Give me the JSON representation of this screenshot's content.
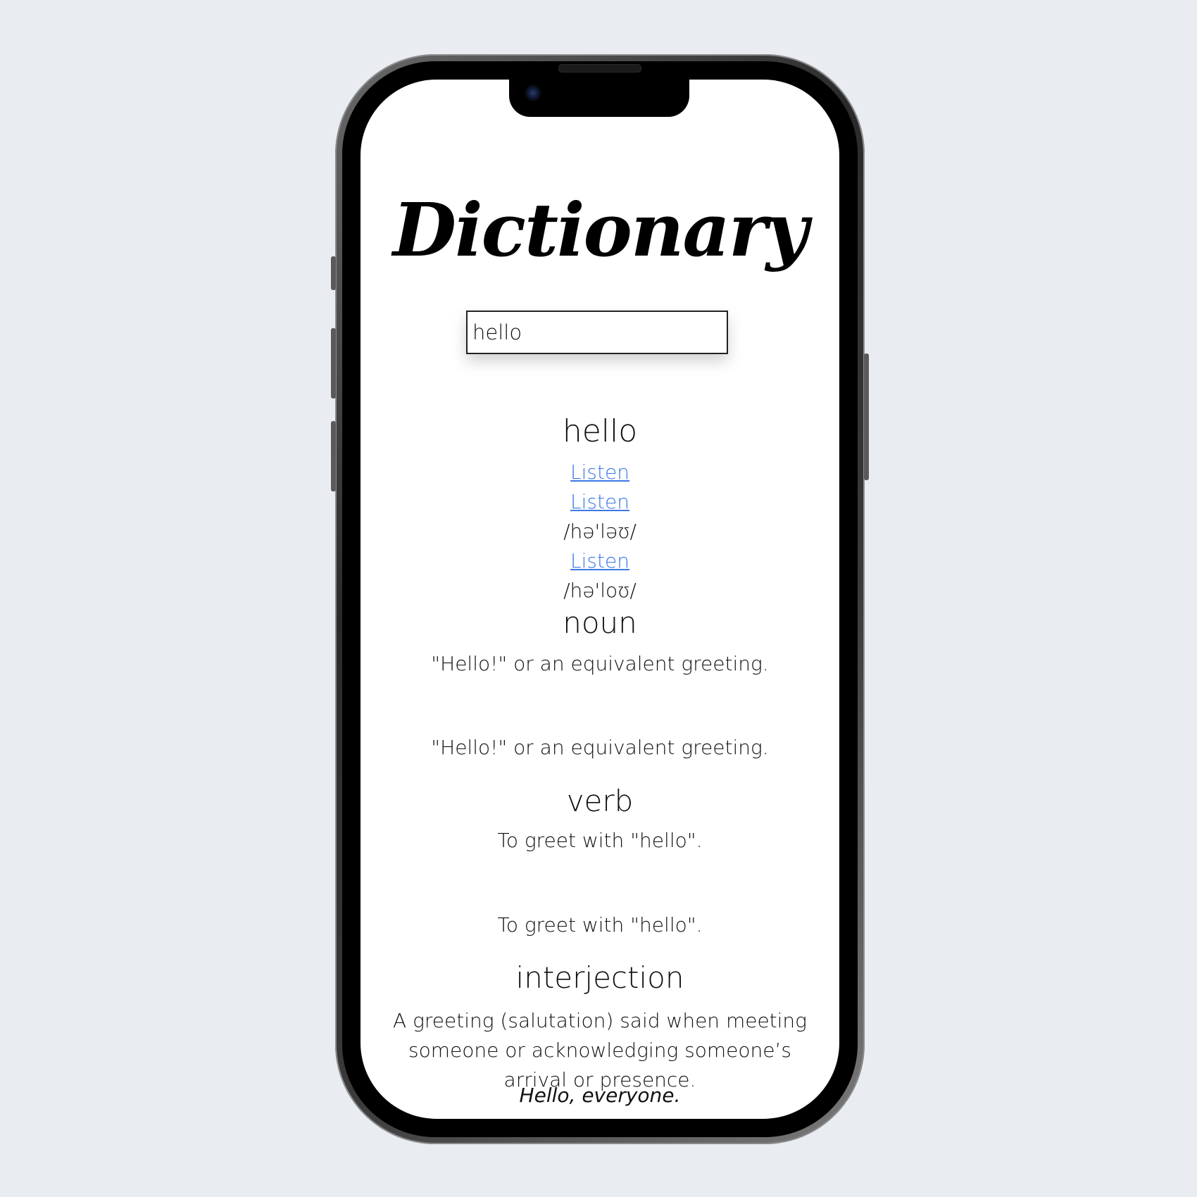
{
  "app": {
    "title": "Dictionary"
  },
  "search": {
    "value": "hello"
  },
  "entry": {
    "word": "hello",
    "phonetics": [
      {
        "listen_label": "Listen",
        "text": ""
      },
      {
        "listen_label": "Listen",
        "text": "/hə'ləʊ/"
      },
      {
        "listen_label": "Listen",
        "text": "/hə'loʊ/"
      }
    ],
    "meanings": [
      {
        "part_of_speech": "noun",
        "definitions": [
          "\"Hello!\" or an equivalent greeting.",
          "\"Hello!\" or an equivalent greeting."
        ]
      },
      {
        "part_of_speech": "verb",
        "definitions": [
          "To greet with \"hello\".",
          "To greet with \"hello\"."
        ]
      },
      {
        "part_of_speech": "interjection",
        "definitions": [
          "A greeting (salutation) said when meeting someone or acknowledging someone’s arrival or presence."
        ],
        "example": "Hello, everyone."
      }
    ]
  }
}
